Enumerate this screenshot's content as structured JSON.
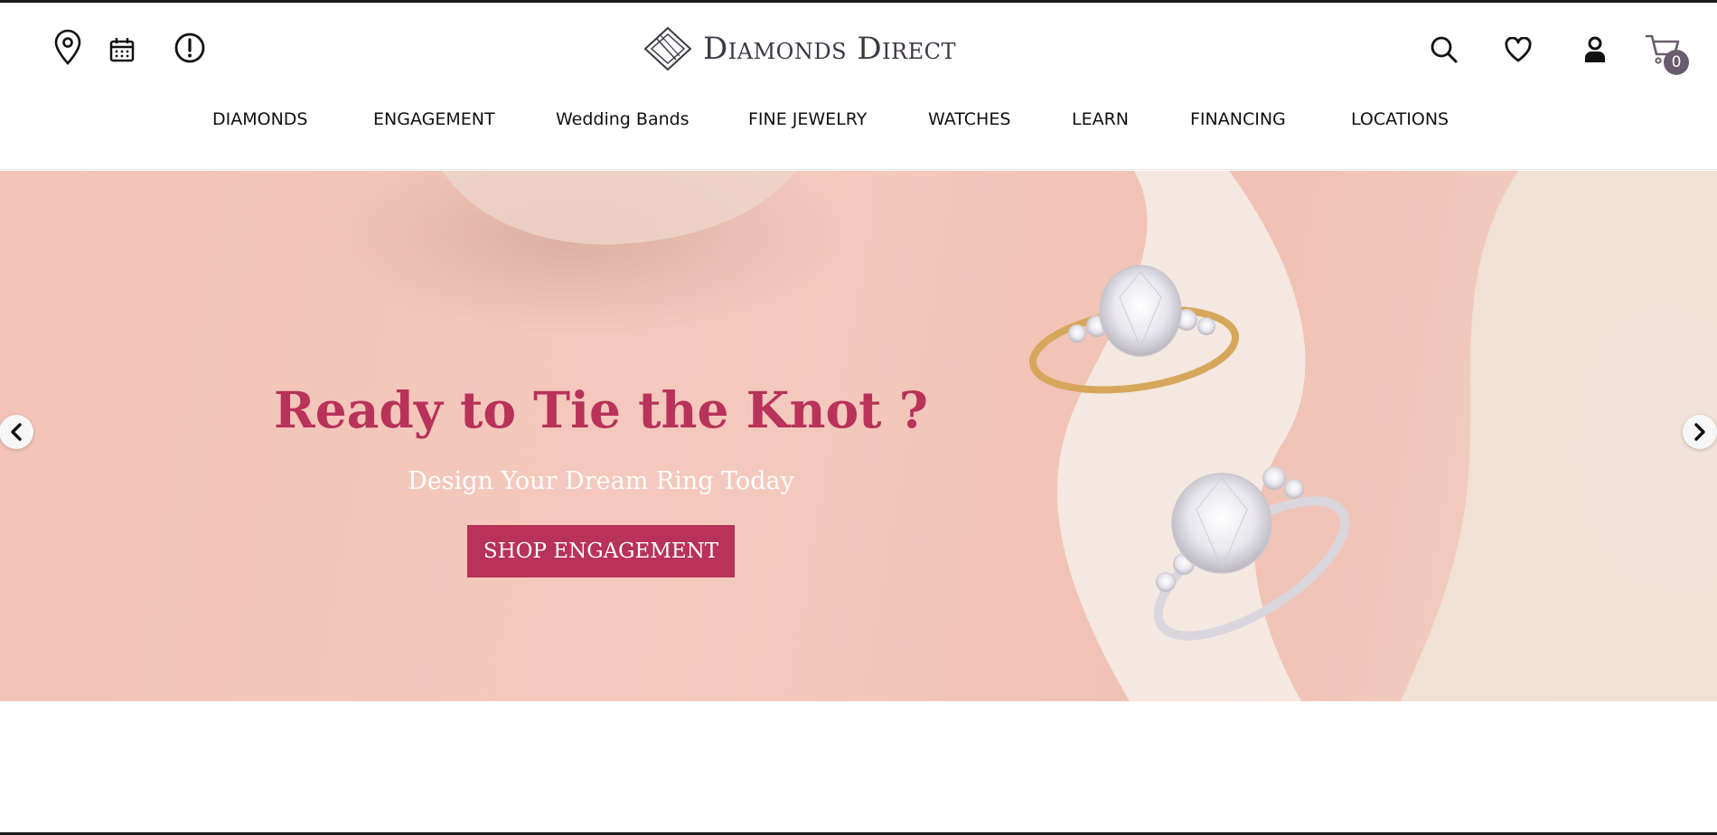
{
  "header": {
    "logo_text": "Diamonds Direct",
    "cart_count": "0",
    "icons": {
      "left": [
        "location-pin-icon",
        "calendar-icon",
        "alert-icon"
      ],
      "right": [
        "search-icon",
        "heart-icon",
        "user-icon",
        "cart-icon"
      ]
    }
  },
  "nav": {
    "items": [
      {
        "label": "DIAMONDS"
      },
      {
        "label": "ENGAGEMENT"
      },
      {
        "label": "Wedding Bands"
      },
      {
        "label": "FINE JEWELRY"
      },
      {
        "label": "WATCHES"
      },
      {
        "label": "LEARN"
      },
      {
        "label": "FINANCING"
      },
      {
        "label": "LOCATIONS"
      }
    ]
  },
  "hero": {
    "heading": "Ready to Tie the Knot ?",
    "subheading": "Design Your Dream Ring Today",
    "cta_label": "SHOP ENGAGEMENT",
    "prev_icon": "chevron-left-icon",
    "next_icon": "chevron-right-icon"
  },
  "colors": {
    "accent": "#b8325a",
    "logo": "#3e3745",
    "badge": "#6b5b6e",
    "hero_background": "#f2c4b7"
  }
}
